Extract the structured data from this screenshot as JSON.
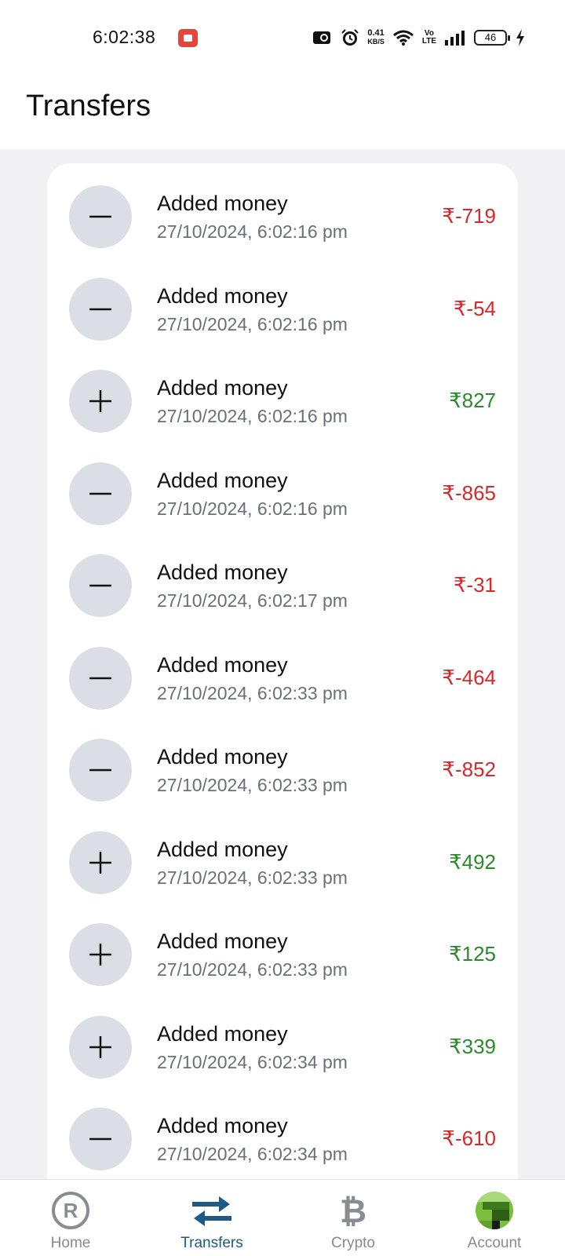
{
  "status_bar": {
    "time": "6:02:38",
    "net_speed_value": "0.41",
    "net_speed_unit": "KB/S",
    "volte_top": "Vo",
    "volte_bottom": "LTE",
    "battery": "46"
  },
  "header": {
    "title": "Transfers"
  },
  "transfers": [
    {
      "sign": "minus",
      "title": "Added money",
      "date": "27/10/2024, 6:02:16 pm",
      "amount": "₹-719",
      "type": "neg"
    },
    {
      "sign": "minus",
      "title": "Added money",
      "date": "27/10/2024, 6:02:16 pm",
      "amount": "₹-54",
      "type": "neg"
    },
    {
      "sign": "plus",
      "title": "Added money",
      "date": "27/10/2024, 6:02:16 pm",
      "amount": "₹827",
      "type": "pos"
    },
    {
      "sign": "minus",
      "title": "Added money",
      "date": "27/10/2024, 6:02:16 pm",
      "amount": "₹-865",
      "type": "neg"
    },
    {
      "sign": "minus",
      "title": "Added money",
      "date": "27/10/2024, 6:02:17 pm",
      "amount": "₹-31",
      "type": "neg"
    },
    {
      "sign": "minus",
      "title": "Added money",
      "date": "27/10/2024, 6:02:33 pm",
      "amount": "₹-464",
      "type": "neg"
    },
    {
      "sign": "minus",
      "title": "Added money",
      "date": "27/10/2024, 6:02:33 pm",
      "amount": "₹-852",
      "type": "neg"
    },
    {
      "sign": "plus",
      "title": "Added money",
      "date": "27/10/2024, 6:02:33 pm",
      "amount": "₹492",
      "type": "pos"
    },
    {
      "sign": "plus",
      "title": "Added money",
      "date": "27/10/2024, 6:02:33 pm",
      "amount": "₹125",
      "type": "pos"
    },
    {
      "sign": "plus",
      "title": "Added money",
      "date": "27/10/2024, 6:02:34 pm",
      "amount": "₹339",
      "type": "pos"
    },
    {
      "sign": "minus",
      "title": "Added money",
      "date": "27/10/2024, 6:02:34 pm",
      "amount": "₹-610",
      "type": "neg"
    }
  ],
  "nav": {
    "home": {
      "label": "Home",
      "icon": "registered-icon"
    },
    "transfers": {
      "label": "Transfers",
      "icon": "swap-arrows-icon"
    },
    "crypto": {
      "label": "Crypto",
      "icon": "bitcoin-icon"
    },
    "account": {
      "label": "Account",
      "icon": "avatar"
    }
  },
  "colors": {
    "negative": "#d42a2a",
    "positive": "#2b8a2b",
    "nav_active": "#1f5a84"
  }
}
